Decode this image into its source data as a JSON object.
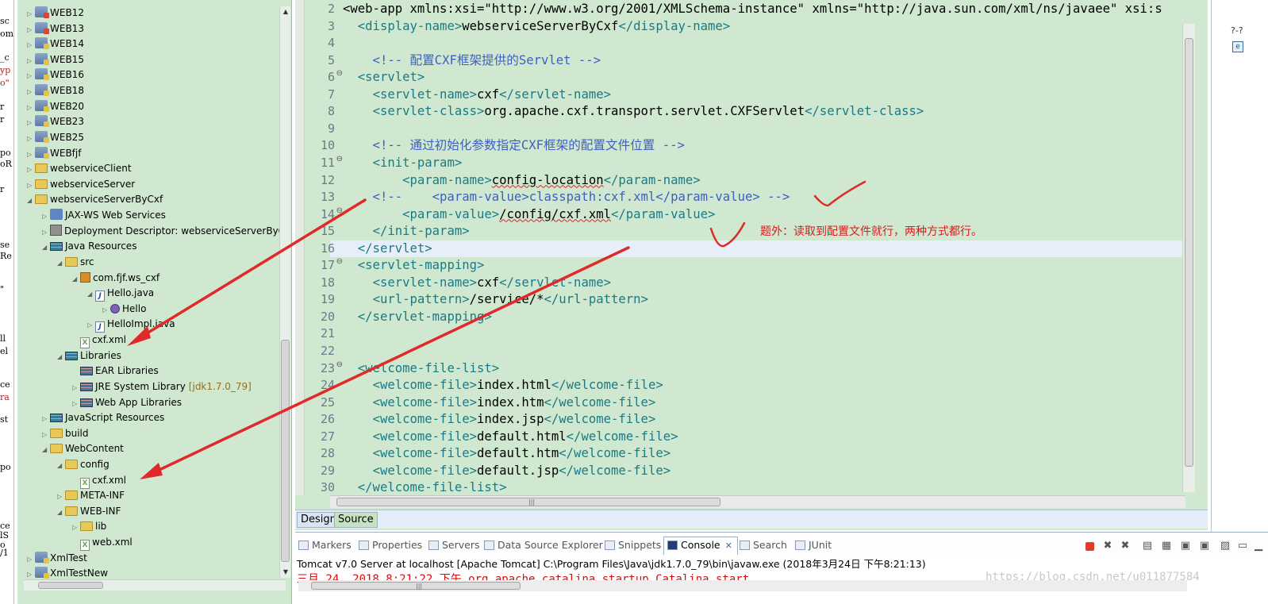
{
  "left_edge": {
    "fragments": [
      "sc",
      "om",
      "_c",
      "yp",
      "o\"",
      "r",
      "r",
      "po",
      "oR",
      "r",
      "se",
      "Re",
      "\"",
      "ll",
      "el",
      "ce",
      "ra",
      "st",
      "po",
      "ce",
      "lS",
      "o",
      "/1"
    ]
  },
  "explorer": {
    "items": [
      {
        "label": "WEB12",
        "icon": "project-error-icon"
      },
      {
        "label": "WEB13",
        "icon": "project-error-icon"
      },
      {
        "label": "WEB14",
        "icon": "project-warning-icon"
      },
      {
        "label": "WEB15",
        "icon": "project-warning-icon"
      },
      {
        "label": "WEB16",
        "icon": "project-warning-icon"
      },
      {
        "label": "WEB18",
        "icon": "project-warning-icon"
      },
      {
        "label": "WEB20",
        "icon": "project-warning-icon"
      },
      {
        "label": "WEB23",
        "icon": "project-warning-icon"
      },
      {
        "label": "WEB25",
        "icon": "project-warning-icon"
      },
      {
        "label": "WEBfjf",
        "icon": "project-warning-icon"
      },
      {
        "label": "webserviceClient",
        "icon": "folder-icon"
      },
      {
        "label": "webserviceServer",
        "icon": "folder-icon"
      },
      {
        "label": "webserviceServerByCxf",
        "icon": "folder-icon"
      },
      {
        "label": "JAX-WS Web Services",
        "icon": "webservice-icon"
      },
      {
        "label": "Deployment Descriptor: webserviceServerByCxf",
        "icon": "descriptor-icon"
      },
      {
        "label": "Java Resources",
        "icon": "java-resources-icon"
      },
      {
        "label": "src",
        "icon": "source-folder-icon"
      },
      {
        "label": "com.fjf.ws_cxf",
        "icon": "package-icon"
      },
      {
        "label": "Hello.java",
        "icon": "java-file-icon"
      },
      {
        "label": "Hello",
        "icon": "interface-icon"
      },
      {
        "label": "HelloImpl.java",
        "icon": "java-file-icon"
      },
      {
        "label": "cxf.xml",
        "icon": "xml-file-icon"
      },
      {
        "label": "Libraries",
        "icon": "libraries-icon"
      },
      {
        "label": "EAR Libraries",
        "icon": "library-icon"
      },
      {
        "label": "JRE System Library",
        "suffix": "[jdk1.7.0_79]",
        "icon": "library-icon"
      },
      {
        "label": "Web App Libraries",
        "icon": "library-icon"
      },
      {
        "label": "JavaScript Resources",
        "icon": "library-icon"
      },
      {
        "label": "build",
        "icon": "folder-icon"
      },
      {
        "label": "WebContent",
        "icon": "folder-icon"
      },
      {
        "label": "config",
        "icon": "folder-icon"
      },
      {
        "label": "cxf.xml",
        "icon": "xml-file-icon"
      },
      {
        "label": "META-INF",
        "icon": "folder-icon"
      },
      {
        "label": "WEB-INF",
        "icon": "folder-icon"
      },
      {
        "label": "lib",
        "icon": "folder-icon"
      },
      {
        "label": "web.xml",
        "icon": "xml-file-icon"
      },
      {
        "label": "XmlTest",
        "icon": "project-warning-icon"
      },
      {
        "label": "XmlTestNew",
        "icon": "project-warning-icon"
      }
    ]
  },
  "editor": {
    "line_numbers": [
      "2",
      "3",
      "4",
      "5",
      "6",
      "7",
      "8",
      "9",
      "10",
      "11",
      "12",
      "13",
      "14",
      "15",
      "16",
      "17",
      "18",
      "19",
      "20",
      "21",
      "22",
      "23",
      "24",
      "25",
      "26",
      "27",
      "28",
      "29",
      "30"
    ],
    "lines": [
      "<web-app xmlns:xsi=\"http://www.w3.org/2001/XMLSchema-instance\" xmlns=\"http://java.sun.com/xml/ns/javaee\" xsi:s",
      "  <display-name>webserviceServerByCxf</display-name>",
      "",
      "    <!-- 配置CXF框架提供的Servlet -->",
      "  <servlet>",
      "    <servlet-name>cxf</servlet-name>",
      "    <servlet-class>org.apache.cxf.transport.servlet.CXFServlet</servlet-class>",
      "",
      "    <!-- 通过初始化参数指定CXF框架的配置文件位置 -->",
      "    <init-param>",
      "        <param-name>config-location</param-name>",
      "    <!--    <param-value>classpath:cxf.xml</param-value> -->",
      "        <param-value>/config/cxf.xml</param-value>",
      "    </init-param>",
      "  </servlet>",
      "  <servlet-mapping>",
      "    <servlet-name>cxf</servlet-name>",
      "    <url-pattern>/service/*</url-pattern>",
      "  </servlet-mapping>",
      "",
      "",
      "  <welcome-file-list>",
      "    <welcome-file>index.html</welcome-file>",
      "    <welcome-file>index.htm</welcome-file>",
      "    <welcome-file>index.jsp</welcome-file>",
      "    <welcome-file>default.html</welcome-file>",
      "    <welcome-file>default.htm</welcome-file>",
      "    <welcome-file>default.jsp</welcome-file>",
      "  </welcome-file-list>"
    ],
    "annotation": "题外：读取到配置文件就行，两种方式都行。",
    "tabs": {
      "design": "Design",
      "source": "Source"
    }
  },
  "console": {
    "tabs": {
      "markers": "Markers",
      "properties": "Properties",
      "servers": "Servers",
      "datasource": "Data Source Explorer",
      "snippets": "Snippets",
      "console": "Console",
      "search": "Search",
      "junit": "JUnit"
    },
    "process": "Tomcat v7.0 Server at localhost [Apache Tomcat] C:\\Program Files\\Java\\jdk1.7.0_79\\bin\\javaw.exe (2018年3月24日 下午8:21:13)",
    "log": "三月 24, 2018 8:21:22 下午 org.apache.catalina.startup.Catalina start",
    "watermark": "https://blog.csdn.net/u011877584"
  },
  "right_strip": {
    "label": "?-?",
    "icon_letter": "e"
  },
  "colors": {
    "editor_bg": "#cfe8cf",
    "tag": "#1a7a86",
    "comment": "#3f5fbf",
    "arrow": "#e02a2a"
  }
}
